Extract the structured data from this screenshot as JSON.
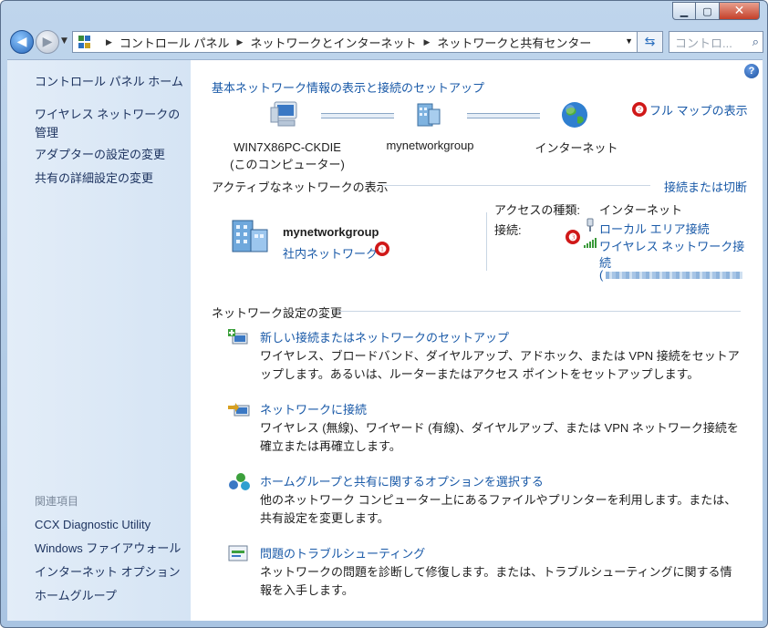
{
  "window": {
    "minimize_glyph": "▁",
    "maximize_glyph": "▢",
    "close_glyph": "✕"
  },
  "nav": {
    "breadcrumbs": [
      "コントロール パネル",
      "ネットワークとインターネット",
      "ネットワークと共有センター"
    ],
    "search_placeholder": "コントロ..."
  },
  "sidebar": {
    "home": "コントロール パネル ホーム",
    "items": [
      "ワイヤレス ネットワークの管理",
      "アダプターの設定の変更",
      "共有の詳細設定の変更"
    ],
    "related_heading": "関連項目",
    "related": [
      "CCX Diagnostic Utility",
      "Windows ファイアウォール",
      "インターネット オプション",
      "ホームグループ"
    ]
  },
  "main": {
    "heading": "基本ネットワーク情報の表示と接続のセットアップ",
    "full_map": "フル マップの表示",
    "map": {
      "computer_line1": "WIN7X86PC-CKDIE",
      "computer_line2": "(このコンピューター)",
      "network": "mynetworkgroup",
      "internet": "インターネット"
    },
    "active_heading": "アクティブなネットワークの表示",
    "connect_disconnect": "接続または切断",
    "active": {
      "name": "mynetworkgroup",
      "type": "社内ネットワーク",
      "access_label": "アクセスの種類:",
      "access_value": "インターネット",
      "connections_label": "接続:",
      "conn_local": "ローカル エリア接続",
      "conn_wireless_line1": "ワイヤレス ネットワーク接",
      "conn_wireless_line2": "続",
      "conn_ssid_prefix": "("
    },
    "change_heading": "ネットワーク設定の変更",
    "settings": [
      {
        "title": "新しい接続またはネットワークのセットアップ",
        "desc": "ワイヤレス、ブロードバンド、ダイヤルアップ、アドホック、または VPN 接続をセットアップします。あるいは、ルーターまたはアクセス ポイントをセットアップします。"
      },
      {
        "title": "ネットワークに接続",
        "desc": "ワイヤレス (無線)、ワイヤード (有線)、ダイヤルアップ、または VPN ネットワーク接続を確立または再確立します。"
      },
      {
        "title": "ホームグループと共有に関するオプションを選択する",
        "desc": "他のネットワーク コンピューター上にあるファイルやプリンターを利用します。または、共有設定を変更します。"
      },
      {
        "title": "問題のトラブルシューティング",
        "desc": "ネットワークの問題を診断して修復します。または、トラブルシューティングに関する情報を入手します。"
      }
    ],
    "markers": [
      "❶",
      "❷",
      "❸"
    ]
  },
  "colors": {
    "link": "#1a5aa8",
    "marker": "#d01818",
    "sidebar_bg": "#e3edf8"
  }
}
